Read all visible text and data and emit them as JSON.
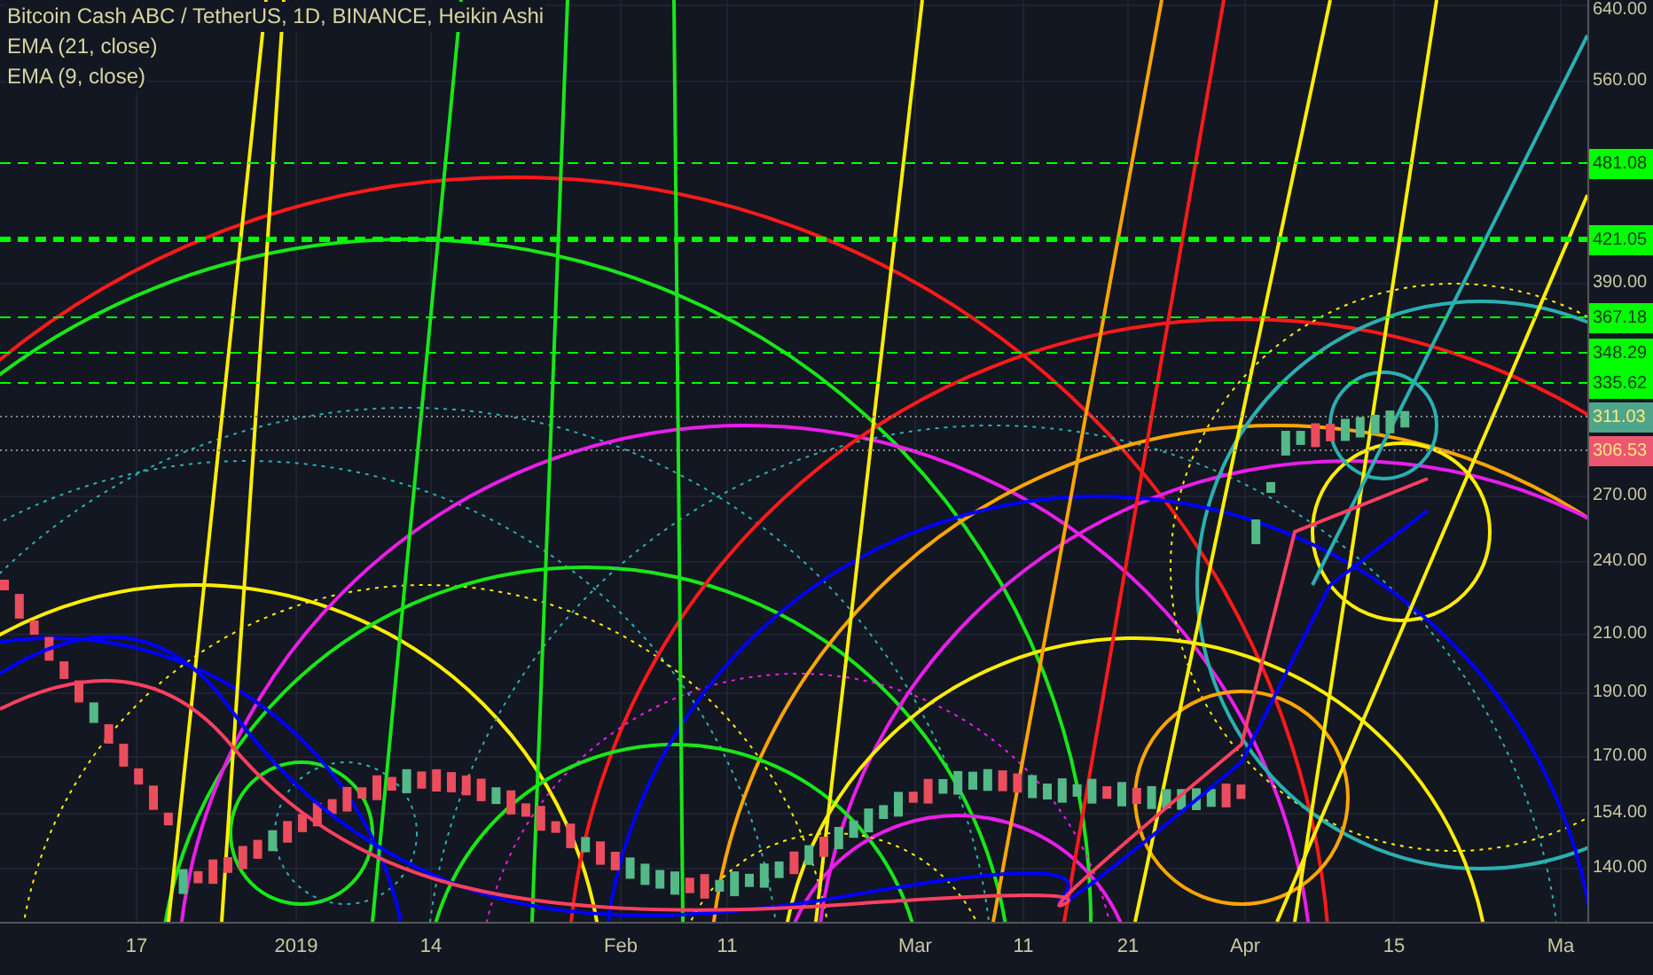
{
  "legend": [
    "Bitcoin Cash ABC / TetherUS, 1D, BINANCE, Heikin Ashi",
    "EMA (21, close)",
    "EMA (9, close)"
  ],
  "price_axis": [
    "640.00",
    "560.00",
    "390.00",
    "270.00",
    "240.00",
    "210.00",
    "190.00",
    "170.00",
    "154.00",
    "140.00"
  ],
  "price_badges": [
    {
      "text": "481.08",
      "color": "#00ff00"
    },
    {
      "text": "421.05",
      "color": "#00ff00"
    },
    {
      "text": "367.18",
      "color": "#00ff00"
    },
    {
      "text": "348.29",
      "color": "#00ff00"
    },
    {
      "text": "335.62",
      "color": "#00ff00"
    },
    {
      "text": "311.03",
      "color": "#4fa58a"
    },
    {
      "text": "306.53",
      "color": "#ec5670"
    }
  ],
  "time_axis": [
    "17",
    "2019",
    "14",
    "Feb",
    "11",
    "Mar",
    "11",
    "21",
    "Apr",
    "15",
    "Ma"
  ]
}
